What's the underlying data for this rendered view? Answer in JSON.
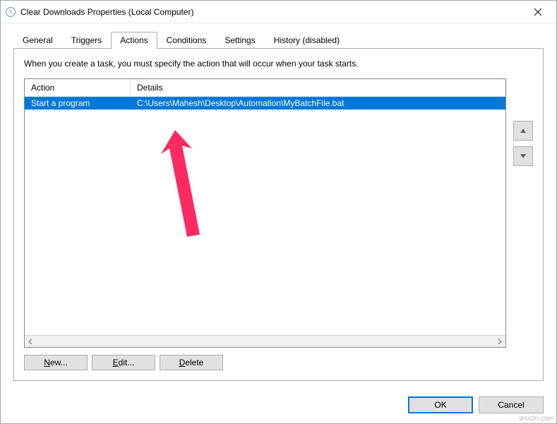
{
  "window": {
    "title": "Clear Downloads Properties (Local Computer)"
  },
  "tabs": {
    "general": "General",
    "triggers": "Triggers",
    "actions": "Actions",
    "conditions": "Conditions",
    "settings": "Settings",
    "history": "History (disabled)"
  },
  "panel": {
    "description": "When you create a task, you must specify the action that will occur when your task starts."
  },
  "list": {
    "headers": {
      "action": "Action",
      "details": "Details"
    },
    "rows": [
      {
        "action": "Start a program",
        "details": "C:\\Users\\Mahesh\\Desktop\\Automation\\MyBatchFile.bat"
      }
    ]
  },
  "buttons": {
    "new": "New...",
    "edit": "Edit...",
    "delete": "Delete",
    "ok": "OK",
    "cancel": "Cancel"
  },
  "watermark": "wsxdn.com"
}
